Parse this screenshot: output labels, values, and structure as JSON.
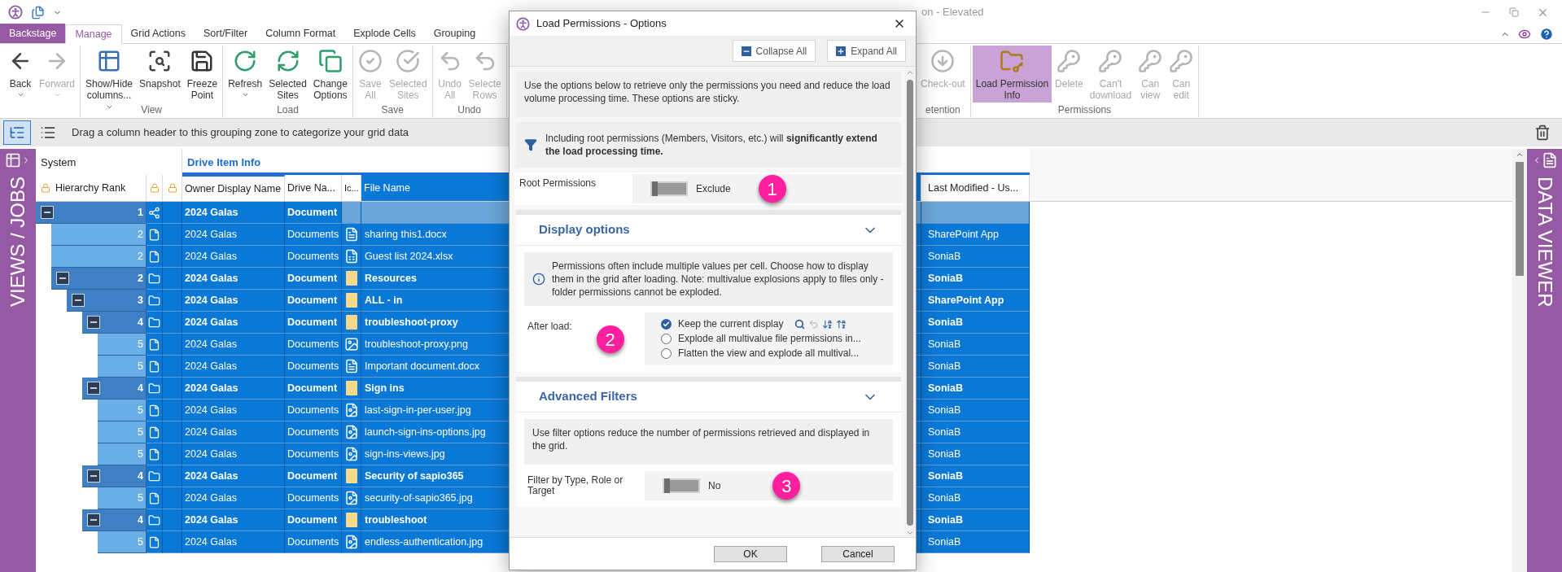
{
  "title_bar": {
    "title": "on - Elevated"
  },
  "tabs": [
    {
      "label": "Backstage",
      "kind": "backstage",
      "selected": false
    },
    {
      "label": "Manage",
      "kind": "tab",
      "selected": true
    },
    {
      "label": "Grid Actions",
      "kind": "tab",
      "selected": false
    },
    {
      "label": "Sort/Filter",
      "kind": "tab",
      "selected": false
    },
    {
      "label": "Column Format",
      "kind": "tab",
      "selected": false
    },
    {
      "label": "Explode Cells",
      "kind": "tab",
      "selected": false
    },
    {
      "label": "Grouping",
      "kind": "tab",
      "selected": false
    }
  ],
  "ribbon_left": [
    {
      "buttons": [
        {
          "label": "Back",
          "kind": "back",
          "dropdown": true,
          "disabled": false,
          "selected": false
        },
        {
          "label": "Forward",
          "kind": "forward",
          "dropdown": true,
          "disabled": true,
          "selected": false
        }
      ]
    },
    {
      "label": "View",
      "buttons": [
        {
          "label": "Show/Hide\ncolumns...",
          "kind": "columns",
          "dropdown": true,
          "disabled": false,
          "selected": false
        },
        {
          "label": "Snapshot",
          "kind": "snapshot",
          "disabled": false,
          "selected": false
        },
        {
          "label": "Freeze\nPoint",
          "kind": "freeze",
          "disabled": false,
          "selected": false
        }
      ]
    },
    {
      "label": "Load",
      "buttons": [
        {
          "label": "Refresh",
          "kind": "refresh",
          "dropdown": true,
          "disabled": false,
          "selected": false
        },
        {
          "label": "Selected\nSites",
          "kind": "sites",
          "disabled": false,
          "selected": false
        },
        {
          "label": "Change\nOptions",
          "kind": "options",
          "disabled": false,
          "selected": false
        }
      ]
    },
    {
      "label": "Save",
      "buttons": [
        {
          "label": "Save\nAll",
          "kind": "save",
          "disabled": true,
          "selected": false
        },
        {
          "label": "Selected\nSites",
          "kind": "save_sites",
          "disabled": true,
          "selected": false
        }
      ]
    },
    {
      "label": "Undo",
      "buttons": [
        {
          "label": "Undo\nAll",
          "kind": "undo",
          "disabled": true,
          "selected": false
        },
        {
          "label": "Selecte\nRows",
          "kind": "undo",
          "disabled": true,
          "selected": false
        }
      ]
    }
  ],
  "ribbon_right": [
    {
      "label": "etention",
      "buttons": [
        {
          "label": "Check-out",
          "kind": "checkout",
          "disabled": true,
          "selected": false
        }
      ]
    },
    {
      "label": "Permissions",
      "buttons": [
        {
          "label": "Load Permission\nInfo",
          "kind": "permissions",
          "disabled": false,
          "selected": true
        },
        {
          "label": "Delete",
          "kind": "key",
          "disabled": true,
          "selected": false
        },
        {
          "label": "Can't\ndownload",
          "kind": "key",
          "disabled": true,
          "selected": false
        },
        {
          "label": "Can\nview",
          "kind": "key",
          "disabled": true,
          "selected": false
        },
        {
          "label": "Can\nedit",
          "kind": "key",
          "disabled": true,
          "selected": false
        }
      ]
    }
  ],
  "grouping_bar": {
    "views": [
      {
        "kind": "tree",
        "selected": true
      },
      {
        "kind": "list",
        "selected": false
      }
    ],
    "hint": "Drag a column header to this grouping zone to categorize your grid data"
  },
  "views_panel": {
    "label": "VIEWS / JOBS"
  },
  "data_viewer": {
    "label": "DATA VIEWER"
  },
  "grid": {
    "group_headers": [
      {
        "label": "System"
      },
      {
        "label": "Drive Item Info"
      }
    ],
    "columns": [
      {
        "label": "Hierarchy Rank",
        "selected": false
      },
      {
        "label": "Owner Display Name",
        "selected": false
      },
      {
        "label": "Drive Na...",
        "selected": false
      },
      {
        "label": "Ic...",
        "selected": false
      },
      {
        "label": "File Name",
        "selected": true
      },
      {
        "label": "Last Modified - Us...",
        "selected": false
      }
    ],
    "rows": [
      {
        "rank": "1",
        "kind": "site",
        "expanded": true,
        "selected": true,
        "owner": "2024 Galas",
        "drive": "Document",
        "children": [
          {
            "rank": "2",
            "kind": "word",
            "selected": true,
            "owner": "2024 Galas",
            "drive": "Documents",
            "file_name": "sharing this1.docx",
            "modified": "SharePoint App"
          },
          {
            "rank": "2",
            "kind": "excel",
            "selected": true,
            "owner": "2024 Galas",
            "drive": "Documents",
            "file_name": "Guest list 2024.xlsx",
            "modified": "SoniaB"
          },
          {
            "rank": "2",
            "kind": "folder",
            "expanded": true,
            "selected": true,
            "owner": "2024 Galas",
            "drive": "Document",
            "file_name": "Resources",
            "modified": "SoniaB",
            "children": [
              {
                "rank": "3",
                "kind": "folder",
                "expanded": true,
                "selected": true,
                "owner": "2024 Galas",
                "drive": "Document",
                "file_name": "ALL - in",
                "modified": "SharePoint App",
                "children": [
                  {
                    "rank": "4",
                    "kind": "folder",
                    "expanded": true,
                    "selected": true,
                    "owner": "2024 Galas",
                    "drive": "Document",
                    "file_name": "troubleshoot-proxy",
                    "modified": "SoniaB",
                    "children": [
                      {
                        "rank": "5",
                        "kind": "image",
                        "selected": true,
                        "owner": "2024 Galas",
                        "drive": "Documents",
                        "file_name": "troubleshoot-proxy.png",
                        "modified": "SoniaB"
                      },
                      {
                        "rank": "5",
                        "kind": "word",
                        "selected": true,
                        "owner": "2024 Galas",
                        "drive": "Documents",
                        "file_name": "Important document.docx",
                        "modified": "SoniaB"
                      }
                    ]
                  },
                  {
                    "rank": "4",
                    "kind": "folder",
                    "expanded": true,
                    "selected": true,
                    "owner": "2024 Galas",
                    "drive": "Document",
                    "file_name": "Sign ins",
                    "modified": "SoniaB",
                    "children": [
                      {
                        "rank": "5",
                        "kind": "photo",
                        "selected": true,
                        "owner": "2024 Galas",
                        "drive": "Documents",
                        "file_name": "last-sign-in-per-user.jpg",
                        "modified": "SoniaB"
                      },
                      {
                        "rank": "5",
                        "kind": "photo",
                        "selected": true,
                        "owner": "2024 Galas",
                        "drive": "Documents",
                        "file_name": "launch-sign-ins-options.jpg",
                        "modified": "SoniaB"
                      },
                      {
                        "rank": "5",
                        "kind": "photo",
                        "selected": true,
                        "owner": "2024 Galas",
                        "drive": "Documents",
                        "file_name": "sign-ins-views.jpg",
                        "modified": "SoniaB"
                      }
                    ]
                  },
                  {
                    "rank": "4",
                    "kind": "folder",
                    "expanded": true,
                    "selected": true,
                    "owner": "2024 Galas",
                    "drive": "Document",
                    "file_name": "Security of sapio365",
                    "modified": "SoniaB",
                    "children": [
                      {
                        "rank": "5",
                        "kind": "photo",
                        "selected": true,
                        "owner": "2024 Galas",
                        "drive": "Documents",
                        "file_name": "security-of-sapio365.jpg",
                        "modified": "SoniaB"
                      }
                    ]
                  },
                  {
                    "rank": "4",
                    "kind": "folder",
                    "expanded": true,
                    "selected": true,
                    "owner": "2024 Galas",
                    "drive": "Document",
                    "file_name": "troubleshoot",
                    "modified": "SoniaB",
                    "children": [
                      {
                        "rank": "5",
                        "kind": "photo",
                        "selected": true,
                        "owner": "2024 Galas",
                        "drive": "Documents",
                        "file_name": "endless-authentication.jpg",
                        "modified": "SoniaB"
                      }
                    ]
                  }
                ]
              }
            ]
          }
        ]
      }
    ]
  },
  "dialog": {
    "title": "Load Permissions - Options",
    "toolbar": [
      {
        "label": "Collapse All",
        "kind": "collapse"
      },
      {
        "label": "Expand All",
        "kind": "expand"
      }
    ],
    "intro": "Use the options below to retrieve only the permissions you need and reduce the load volume processing time. These options are sticky.",
    "warning": "Including root permissions (Members, Visitors, etc.) will **significantly extend the load processing time.**",
    "root_permissions": {
      "label": "Root Permissions",
      "on": false,
      "value": "Exclude",
      "badge": "1"
    },
    "sections": [
      {
        "kind": "display",
        "title": "Display options",
        "expanded": true,
        "note": "Permissions often include multiple values per cell. Choose how to display them in the grid after loading. Note: multivalue explosions apply to files only - folder permissions cannot be exploded.",
        "after_load": {
          "label": "After load:",
          "badge": "2",
          "options": [
            {
              "label": "Keep the current display",
              "selected": true
            },
            {
              "label": "Explode all multivalue file permissions in...",
              "selected": false
            },
            {
              "label": "Flatten the view and explode all multival...",
              "selected": false
            }
          ]
        }
      },
      {
        "kind": "filters",
        "title": "Advanced Filters",
        "expanded": true,
        "note": "Use filter options reduce the number of permissions retrieved and displayed in the grid.",
        "filter": {
          "label": "Filter by Type, Role or Target",
          "on": false,
          "value": "No",
          "badge": "3"
        }
      }
    ],
    "buttons": [
      {
        "label": "OK"
      },
      {
        "label": "Cancel"
      }
    ]
  }
}
